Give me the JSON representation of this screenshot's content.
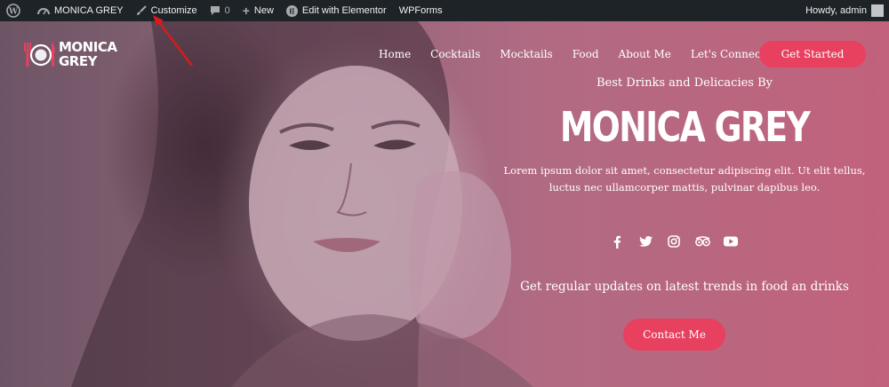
{
  "admin_bar": {
    "site_name": "MONICA GREY",
    "customize": "Customize",
    "comments_count": "0",
    "new": "New",
    "elementor": "Edit with Elementor",
    "wpforms": "WPForms",
    "greeting": "Howdy, admin"
  },
  "header": {
    "logo_line1": "MONICA",
    "logo_line2": "GREY",
    "nav": [
      "Home",
      "Cocktails",
      "Mocktails",
      "Food",
      "About Me",
      "Let's Connect"
    ],
    "cta": "Get Started"
  },
  "hero": {
    "kicker": "Best Drinks and Delicacies By",
    "title": "MONICA GREY",
    "description": "Lorem ipsum dolor sit amet, consectetur adipiscing elit. Ut elit tellus, luctus nec ullamcorper mattis, pulvinar dapibus leo.",
    "socials": [
      "facebook-icon",
      "twitter-icon",
      "instagram-icon",
      "tripadvisor-icon",
      "youtube-icon"
    ],
    "updates": "Get regular updates on latest trends in food an drinks",
    "contact": "Contact Me"
  },
  "colors": {
    "admin_bar": "#1d2327",
    "accent": "#e8405f",
    "annotation_arrow": "#d41c1c"
  }
}
